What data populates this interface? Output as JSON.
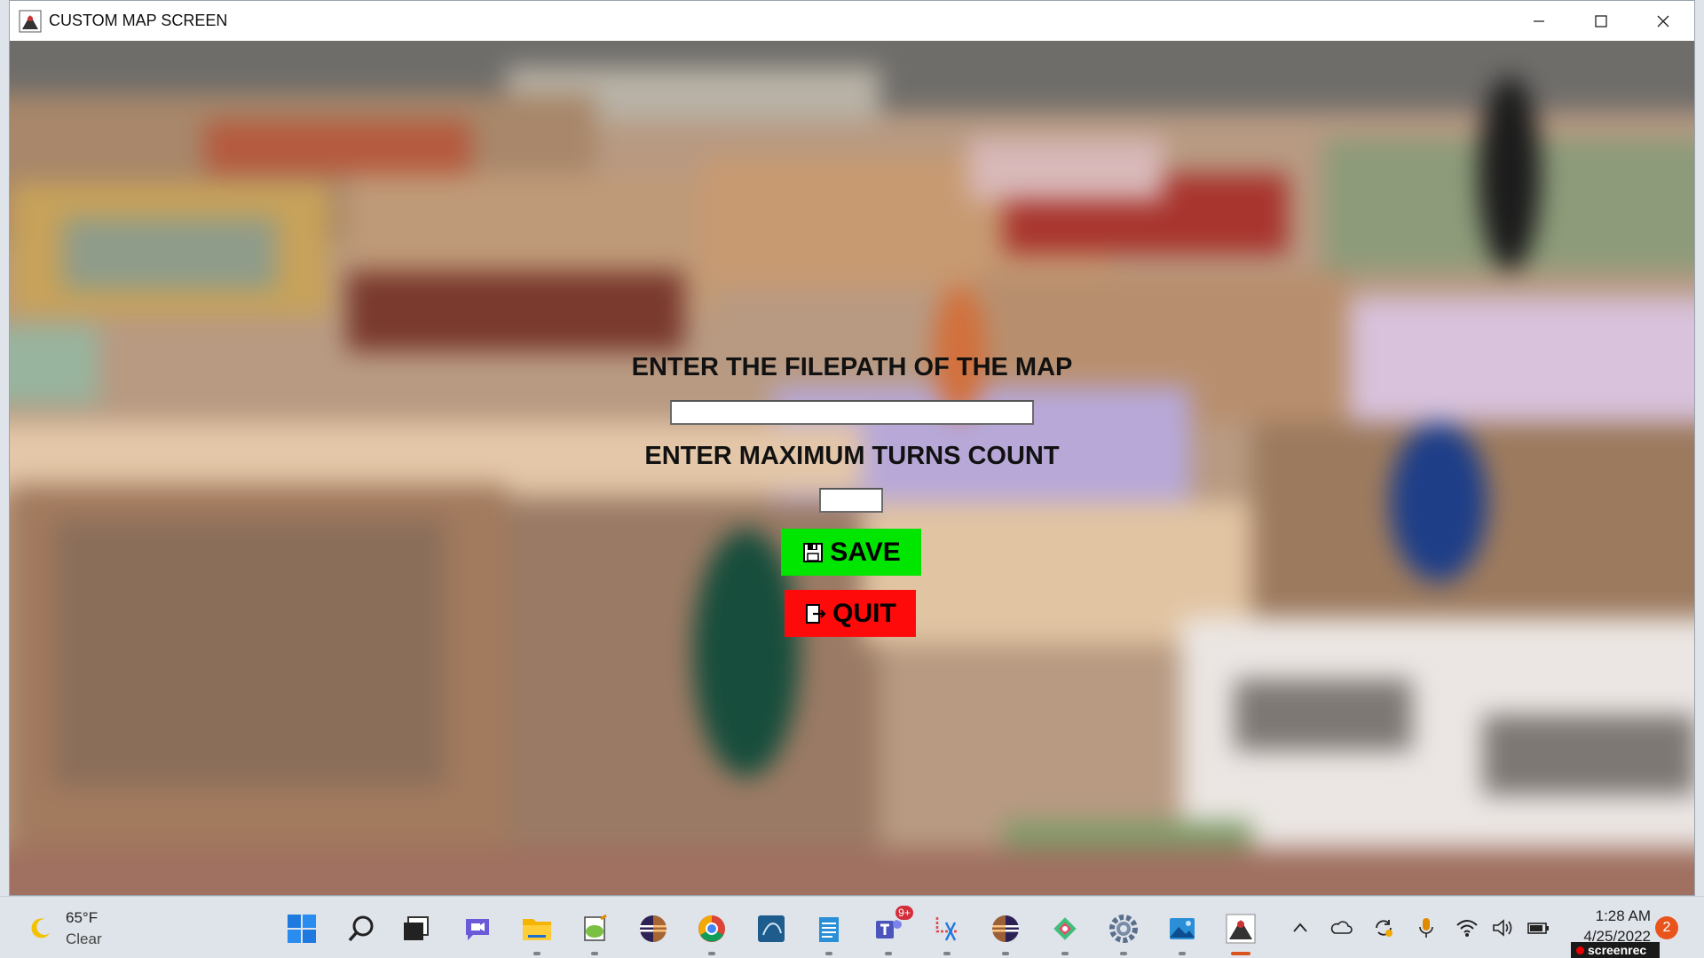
{
  "window": {
    "title": "CUSTOM MAP SCREEN",
    "controls": {
      "minimize": "—",
      "maximize": "☐",
      "close": "✕"
    }
  },
  "form": {
    "filepath_label": "ENTER THE FILEPATH OF THE MAP",
    "filepath_value": "",
    "turns_label": "ENTER MAXIMUM TURNS COUNT",
    "turns_value": "",
    "save_label": "SAVE",
    "quit_label": "QUIT"
  },
  "colors": {
    "save_bg": "#00e600",
    "quit_bg": "#ff0a0a",
    "taskbar_bg": "#dfe3ea"
  },
  "taskbar": {
    "weather": {
      "temp": "65°F",
      "condition": "Clear",
      "icon": "moon-icon"
    },
    "apps": [
      {
        "name": "start-icon"
      },
      {
        "name": "search-icon"
      },
      {
        "name": "task-view-icon"
      },
      {
        "name": "chat-icon"
      },
      {
        "name": "file-explorer-icon"
      },
      {
        "name": "notepad-plus-icon"
      },
      {
        "name": "eclipse-icon"
      },
      {
        "name": "chrome-icon"
      },
      {
        "name": "mysql-workbench-icon"
      },
      {
        "name": "notepad-icon"
      },
      {
        "name": "teams-icon",
        "badge": "9+"
      },
      {
        "name": "snipping-tool-icon"
      },
      {
        "name": "eclipse-ee-icon"
      },
      {
        "name": "git-icon"
      },
      {
        "name": "settings-icon"
      },
      {
        "name": "photos-icon"
      },
      {
        "name": "java-app-icon"
      }
    ],
    "tray": [
      "chevron-up-icon",
      "onedrive-icon",
      "sync-icon",
      "microphone-icon",
      "wifi-icon",
      "volume-icon",
      "battery-icon"
    ],
    "clock": {
      "time": "1:28 AM",
      "date": "4/25/2022"
    },
    "notifications": "2",
    "watermark": "screenrec"
  }
}
